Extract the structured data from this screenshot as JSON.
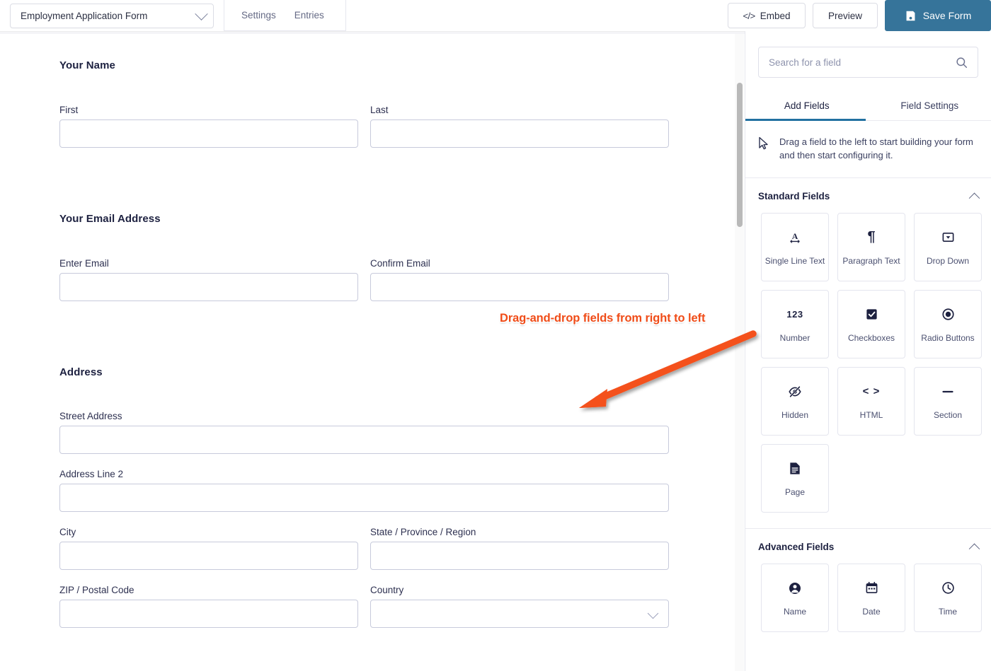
{
  "header": {
    "form_selector_value": "Employment Application Form",
    "form_selector_icon": "chevron-down-icon",
    "nav": [
      {
        "label": "Settings"
      },
      {
        "label": "Entries"
      }
    ],
    "embed_label": "Embed",
    "embed_icon": "code-icon",
    "preview_label": "Preview",
    "save_label": "Save Form",
    "save_icon": "floppy-disk-icon",
    "save_bg_color": "#36749a"
  },
  "form": {
    "sections": [
      {
        "title": "Your Name",
        "rows": [
          [
            {
              "label": "First",
              "type": "text",
              "value": ""
            },
            {
              "label": "Last",
              "type": "text",
              "value": ""
            }
          ]
        ]
      },
      {
        "title": "Your Email Address",
        "rows": [
          [
            {
              "label": "Enter Email",
              "type": "text",
              "value": ""
            },
            {
              "label": "Confirm Email",
              "type": "text",
              "value": ""
            }
          ]
        ]
      },
      {
        "title": "Address",
        "rows": [
          [
            {
              "label": "Street Address",
              "type": "text",
              "value": ""
            }
          ],
          [
            {
              "label": "Address Line 2",
              "type": "text",
              "value": ""
            }
          ],
          [
            {
              "label": "City",
              "type": "text",
              "value": ""
            },
            {
              "label": "State / Province / Region",
              "type": "text",
              "value": ""
            }
          ],
          [
            {
              "label": "ZIP / Postal Code",
              "type": "text",
              "value": ""
            },
            {
              "label": "Country",
              "type": "select",
              "value": ""
            }
          ]
        ]
      }
    ]
  },
  "panel": {
    "search": {
      "placeholder": "Search for a field",
      "value": "",
      "icon": "search-icon"
    },
    "tabs": [
      {
        "label": "Add Fields",
        "active": true
      },
      {
        "label": "Field Settings",
        "active": false
      }
    ],
    "active_tab_color": "#2271a1",
    "hint": {
      "icon": "cursor-arrow-icon",
      "text": "Drag a field to the left to start building your form and then start configuring it."
    },
    "groups": [
      {
        "title": "Standard Fields",
        "collapse_icon": "chevron-up-icon",
        "fields": [
          {
            "label": "Single Line Text",
            "icon": "underlined-a-icon"
          },
          {
            "label": "Paragraph Text",
            "icon": "pilcrow-icon"
          },
          {
            "label": "Drop Down",
            "icon": "dropdown-box-icon"
          },
          {
            "label": "Number",
            "icon": "numeric-123-icon"
          },
          {
            "label": "Checkboxes",
            "icon": "checkbox-checked-icon"
          },
          {
            "label": "Radio Buttons",
            "icon": "radio-selected-icon"
          },
          {
            "label": "Hidden",
            "icon": "eye-slash-icon"
          },
          {
            "label": "HTML",
            "icon": "angle-brackets-icon"
          },
          {
            "label": "Section",
            "icon": "horizontal-rule-icon"
          },
          {
            "label": "Page",
            "icon": "document-page-icon"
          }
        ]
      },
      {
        "title": "Advanced Fields",
        "collapse_icon": "chevron-up-icon",
        "fields": [
          {
            "label": "Name",
            "icon": "user-circle-icon"
          },
          {
            "label": "Date",
            "icon": "calendar-icon"
          },
          {
            "label": "Time",
            "icon": "clock-icon"
          }
        ]
      }
    ]
  },
  "annotation": {
    "text": "Drag-and-drop fields from right to left",
    "color": "#f04c18",
    "arrow": "orange-arrow-pointing-down-left"
  }
}
